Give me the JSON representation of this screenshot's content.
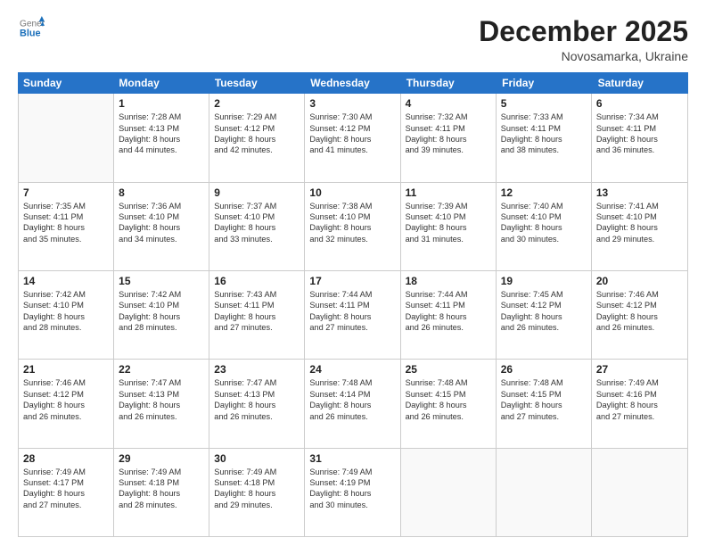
{
  "header": {
    "logo_general": "General",
    "logo_blue": "Blue",
    "month_title": "December 2025",
    "location": "Novosamarka, Ukraine"
  },
  "calendar": {
    "days_of_week": [
      "Sunday",
      "Monday",
      "Tuesday",
      "Wednesday",
      "Thursday",
      "Friday",
      "Saturday"
    ],
    "weeks": [
      [
        {
          "day": "",
          "empty": true
        },
        {
          "day": "1",
          "sunrise": "Sunrise: 7:28 AM",
          "sunset": "Sunset: 4:13 PM",
          "daylight": "Daylight: 8 hours",
          "minutes": "and 44 minutes."
        },
        {
          "day": "2",
          "sunrise": "Sunrise: 7:29 AM",
          "sunset": "Sunset: 4:12 PM",
          "daylight": "Daylight: 8 hours",
          "minutes": "and 42 minutes."
        },
        {
          "day": "3",
          "sunrise": "Sunrise: 7:30 AM",
          "sunset": "Sunset: 4:12 PM",
          "daylight": "Daylight: 8 hours",
          "minutes": "and 41 minutes."
        },
        {
          "day": "4",
          "sunrise": "Sunrise: 7:32 AM",
          "sunset": "Sunset: 4:11 PM",
          "daylight": "Daylight: 8 hours",
          "minutes": "and 39 minutes."
        },
        {
          "day": "5",
          "sunrise": "Sunrise: 7:33 AM",
          "sunset": "Sunset: 4:11 PM",
          "daylight": "Daylight: 8 hours",
          "minutes": "and 38 minutes."
        },
        {
          "day": "6",
          "sunrise": "Sunrise: 7:34 AM",
          "sunset": "Sunset: 4:11 PM",
          "daylight": "Daylight: 8 hours",
          "minutes": "and 36 minutes."
        }
      ],
      [
        {
          "day": "7",
          "sunrise": "Sunrise: 7:35 AM",
          "sunset": "Sunset: 4:11 PM",
          "daylight": "Daylight: 8 hours",
          "minutes": "and 35 minutes."
        },
        {
          "day": "8",
          "sunrise": "Sunrise: 7:36 AM",
          "sunset": "Sunset: 4:10 PM",
          "daylight": "Daylight: 8 hours",
          "minutes": "and 34 minutes."
        },
        {
          "day": "9",
          "sunrise": "Sunrise: 7:37 AM",
          "sunset": "Sunset: 4:10 PM",
          "daylight": "Daylight: 8 hours",
          "minutes": "and 33 minutes."
        },
        {
          "day": "10",
          "sunrise": "Sunrise: 7:38 AM",
          "sunset": "Sunset: 4:10 PM",
          "daylight": "Daylight: 8 hours",
          "minutes": "and 32 minutes."
        },
        {
          "day": "11",
          "sunrise": "Sunrise: 7:39 AM",
          "sunset": "Sunset: 4:10 PM",
          "daylight": "Daylight: 8 hours",
          "minutes": "and 31 minutes."
        },
        {
          "day": "12",
          "sunrise": "Sunrise: 7:40 AM",
          "sunset": "Sunset: 4:10 PM",
          "daylight": "Daylight: 8 hours",
          "minutes": "and 30 minutes."
        },
        {
          "day": "13",
          "sunrise": "Sunrise: 7:41 AM",
          "sunset": "Sunset: 4:10 PM",
          "daylight": "Daylight: 8 hours",
          "minutes": "and 29 minutes."
        }
      ],
      [
        {
          "day": "14",
          "sunrise": "Sunrise: 7:42 AM",
          "sunset": "Sunset: 4:10 PM",
          "daylight": "Daylight: 8 hours",
          "minutes": "and 28 minutes."
        },
        {
          "day": "15",
          "sunrise": "Sunrise: 7:42 AM",
          "sunset": "Sunset: 4:10 PM",
          "daylight": "Daylight: 8 hours",
          "minutes": "and 28 minutes."
        },
        {
          "day": "16",
          "sunrise": "Sunrise: 7:43 AM",
          "sunset": "Sunset: 4:11 PM",
          "daylight": "Daylight: 8 hours",
          "minutes": "and 27 minutes."
        },
        {
          "day": "17",
          "sunrise": "Sunrise: 7:44 AM",
          "sunset": "Sunset: 4:11 PM",
          "daylight": "Daylight: 8 hours",
          "minutes": "and 27 minutes."
        },
        {
          "day": "18",
          "sunrise": "Sunrise: 7:44 AM",
          "sunset": "Sunset: 4:11 PM",
          "daylight": "Daylight: 8 hours",
          "minutes": "and 26 minutes."
        },
        {
          "day": "19",
          "sunrise": "Sunrise: 7:45 AM",
          "sunset": "Sunset: 4:12 PM",
          "daylight": "Daylight: 8 hours",
          "minutes": "and 26 minutes."
        },
        {
          "day": "20",
          "sunrise": "Sunrise: 7:46 AM",
          "sunset": "Sunset: 4:12 PM",
          "daylight": "Daylight: 8 hours",
          "minutes": "and 26 minutes."
        }
      ],
      [
        {
          "day": "21",
          "sunrise": "Sunrise: 7:46 AM",
          "sunset": "Sunset: 4:12 PM",
          "daylight": "Daylight: 8 hours",
          "minutes": "and 26 minutes."
        },
        {
          "day": "22",
          "sunrise": "Sunrise: 7:47 AM",
          "sunset": "Sunset: 4:13 PM",
          "daylight": "Daylight: 8 hours",
          "minutes": "and 26 minutes."
        },
        {
          "day": "23",
          "sunrise": "Sunrise: 7:47 AM",
          "sunset": "Sunset: 4:13 PM",
          "daylight": "Daylight: 8 hours",
          "minutes": "and 26 minutes."
        },
        {
          "day": "24",
          "sunrise": "Sunrise: 7:48 AM",
          "sunset": "Sunset: 4:14 PM",
          "daylight": "Daylight: 8 hours",
          "minutes": "and 26 minutes."
        },
        {
          "day": "25",
          "sunrise": "Sunrise: 7:48 AM",
          "sunset": "Sunset: 4:15 PM",
          "daylight": "Daylight: 8 hours",
          "minutes": "and 26 minutes."
        },
        {
          "day": "26",
          "sunrise": "Sunrise: 7:48 AM",
          "sunset": "Sunset: 4:15 PM",
          "daylight": "Daylight: 8 hours",
          "minutes": "and 27 minutes."
        },
        {
          "day": "27",
          "sunrise": "Sunrise: 7:49 AM",
          "sunset": "Sunset: 4:16 PM",
          "daylight": "Daylight: 8 hours",
          "minutes": "and 27 minutes."
        }
      ],
      [
        {
          "day": "28",
          "sunrise": "Sunrise: 7:49 AM",
          "sunset": "Sunset: 4:17 PM",
          "daylight": "Daylight: 8 hours",
          "minutes": "and 27 minutes."
        },
        {
          "day": "29",
          "sunrise": "Sunrise: 7:49 AM",
          "sunset": "Sunset: 4:18 PM",
          "daylight": "Daylight: 8 hours",
          "minutes": "and 28 minutes."
        },
        {
          "day": "30",
          "sunrise": "Sunrise: 7:49 AM",
          "sunset": "Sunset: 4:18 PM",
          "daylight": "Daylight: 8 hours",
          "minutes": "and 29 minutes."
        },
        {
          "day": "31",
          "sunrise": "Sunrise: 7:49 AM",
          "sunset": "Sunset: 4:19 PM",
          "daylight": "Daylight: 8 hours",
          "minutes": "and 30 minutes."
        },
        {
          "day": "",
          "empty": true
        },
        {
          "day": "",
          "empty": true
        },
        {
          "day": "",
          "empty": true
        }
      ]
    ]
  }
}
